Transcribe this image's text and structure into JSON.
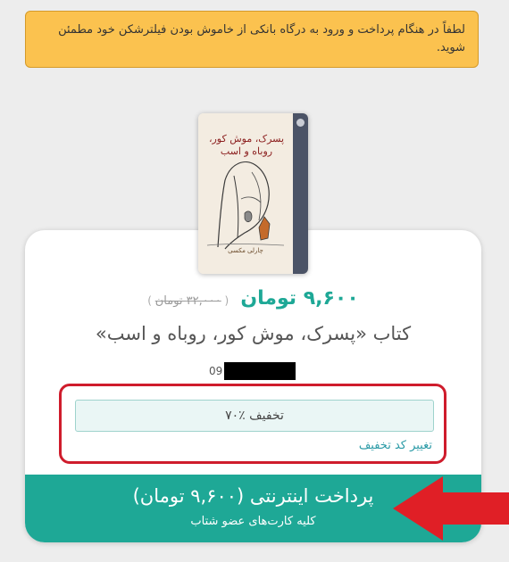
{
  "alert": {
    "text": "لطفاً در هنگام پرداخت و ورود به درگاه بانکی از خاموش بودن فیلترشکن خود مطمئن شوید."
  },
  "book": {
    "title": "پسرک، موش کور، روباه و اسب",
    "author": "چارلی مکسی"
  },
  "product": {
    "price_new": "۹,۶۰۰ تومان",
    "price_old": "۳۲,۰۰۰ تومان",
    "title": "کتاب «پسرک، موش کور، روباه و اسب»",
    "phone_prefix": "09"
  },
  "discount": {
    "label": "تخفیف ٪۷۰",
    "change_link": "تغییر کد تخفیف"
  },
  "payment": {
    "button_label": "پرداخت اینترنتی (۹,۶۰۰ تومان)",
    "button_sub": "کلیه کارت‌های عضو شتاب"
  },
  "colors": {
    "accent": "#1ea896",
    "alert_bg": "#fbc24f",
    "highlight": "#cf1c2c",
    "arrow": "#e01f26"
  }
}
